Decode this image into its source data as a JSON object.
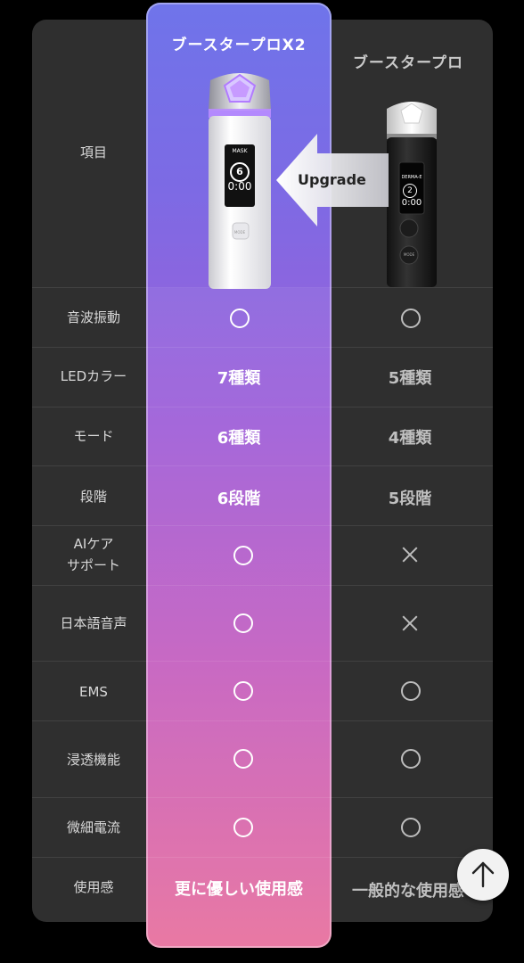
{
  "columns": {
    "highlight": "ブースタープロX2",
    "other": "ブースタープロ"
  },
  "upgrade_label": "Upgrade",
  "devices": {
    "highlight": {
      "screen_label": "MASK",
      "screen_num": "6",
      "screen_time": "0:00",
      "button": "MODE"
    },
    "other": {
      "screen_label": "DERMA-E",
      "screen_num": "2",
      "screen_time": "0:00",
      "button": "MODE"
    }
  },
  "rows": [
    {
      "label": "項目"
    },
    {
      "label": "音波振動",
      "a": "circle",
      "b": "circle"
    },
    {
      "label": "LEDカラー",
      "a": "7種類",
      "b": "5種類"
    },
    {
      "label": "モード",
      "a": "6種類",
      "b": "4種類"
    },
    {
      "label": "段階",
      "a": "6段階",
      "b": "5段階"
    },
    {
      "label": "AIケア\nサポート",
      "a": "circle",
      "b": "cross"
    },
    {
      "label": "日本語音声",
      "a": "circle",
      "b": "cross"
    },
    {
      "label": "EMS",
      "a": "circle",
      "b": "circle"
    },
    {
      "label": "浸透機能",
      "a": "circle",
      "b": "circle"
    },
    {
      "label": "微細電流",
      "a": "circle",
      "b": "circle"
    },
    {
      "label": "使用感",
      "a": "更に優しい使用感",
      "b": "一般的な使用感"
    }
  ],
  "icons": {
    "upgrade_arrow": "left-arrow-icon",
    "scroll_top": "arrow-up-icon",
    "available": "circle-icon",
    "unavailable": "cross-icon"
  },
  "colors": {
    "gradient_top": "#6f74ea",
    "gradient_bottom": "#e8719e",
    "panel": "#2f2f2f"
  }
}
